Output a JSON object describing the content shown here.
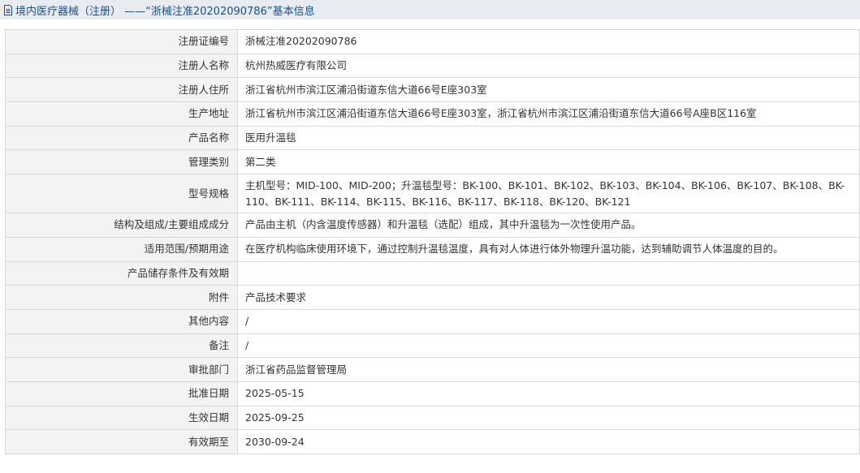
{
  "header": {
    "title": "境内医疗器械（注册） ——“浙械注准20202090786”基本信息"
  },
  "rows": [
    {
      "label": "注册证编号",
      "value": "浙械注准20202090786"
    },
    {
      "label": "注册人名称",
      "value": "杭州热威医疗有限公司"
    },
    {
      "label": "注册人住所",
      "value": "浙江省杭州市滨江区浦沿街道东信大道66号E座303室"
    },
    {
      "label": "生产地址",
      "value": "浙江省杭州市滨江区浦沿街道东信大道66号E座303室，浙江省杭州市滨江区浦沿街道东信大道66号A座B区116室"
    },
    {
      "label": "产品名称",
      "value": "医用升温毯"
    },
    {
      "label": "管理类别",
      "value": "第二类"
    },
    {
      "label": "型号规格",
      "value": "主机型号：MID-100、MID-200；升温毯型号：BK-100、BK-101、BK-102、BK-103、BK-104、BK-106、BK-107、BK-108、BK-110、BK-111、BK-114、BK-115、BK-116、BK-117、BK-118、BK-120、BK-121"
    },
    {
      "label": "结构及组成/主要组成成分",
      "value": "产品由主机（内含温度传感器）和升温毯（选配）组成，其中升温毯为一次性使用产品。"
    },
    {
      "label": "适用范围/预期用途",
      "value": "在医疗机构临床使用环境下，通过控制升温毯温度，具有对人体进行体外物理升温功能，达到辅助调节人体温度的目的。"
    },
    {
      "label": "产品储存条件及有效期",
      "value": ""
    },
    {
      "label": "附件",
      "value": "产品技术要求"
    },
    {
      "label": "其他内容",
      "value": "/"
    },
    {
      "label": "备注",
      "value": "/"
    },
    {
      "label": "审批部门",
      "value": "浙江省药品监督管理局"
    },
    {
      "label": "批准日期",
      "value": "2025-05-15"
    },
    {
      "label": "生效日期",
      "value": "2025-09-25"
    },
    {
      "label": "有效期至",
      "value": "2030-09-24"
    }
  ]
}
